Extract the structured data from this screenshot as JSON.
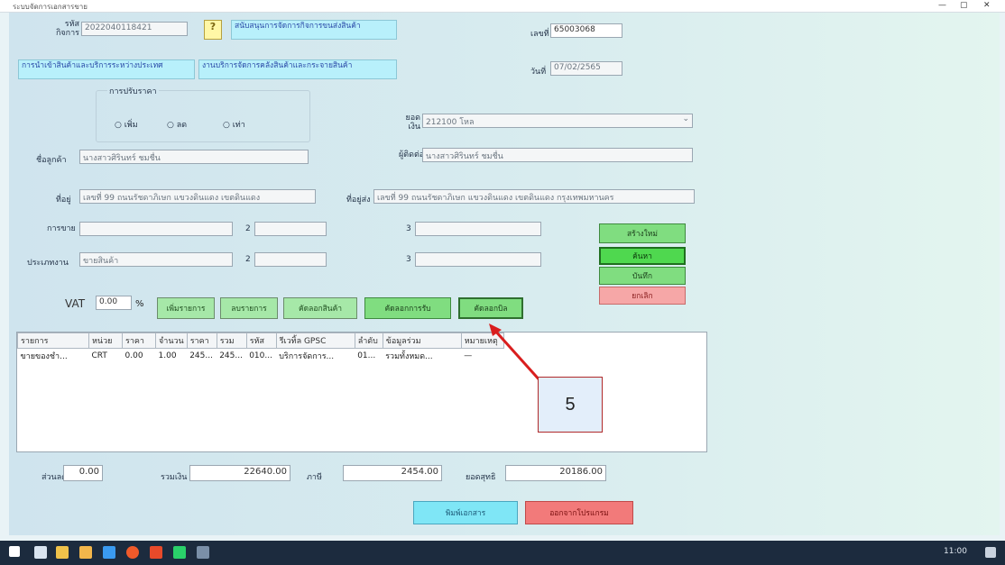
{
  "window": {
    "title": "ระบบจัดการเอกสารขาย",
    "controls": [
      "—",
      "▢",
      "✕"
    ]
  },
  "header": {
    "doc_no_label": "รหัส\nกิจการ",
    "doc_no_value": "2022040118421",
    "lookup_btn": "?",
    "company_desc": "สนับสนุนการจัดการกิจการขนส่งสินค้า",
    "blue_left": "การนำเข้าสินค้าและบริการระหว่างประเทศ",
    "blue_right": "งานบริการจัดการคลังสินค้าและกระจายสินค้า",
    "ref_label": "เลขที่",
    "ref_value": "65003068",
    "date_label": "วันที่",
    "date_value": "07/02/2565"
  },
  "purpose": {
    "group_label": "การปรับราคา",
    "options": [
      "เพิ่ม",
      "ลด",
      "เท่า"
    ]
  },
  "amount": {
    "label": "ยอด\nเงิน",
    "value": "212100 โหล"
  },
  "fields": {
    "customer_label": "ชื่อลูกค้า",
    "customer_value": "นางสาวศิรินทร์ ชมชื่น",
    "contact_label": "ผู้ติดต่อ",
    "contact_value": "นางสาวศิรินทร์ ชมชื่น",
    "address_label": "ที่อยู่",
    "address_value": "เลขที่ 99 ถนนรัชดาภิเษก แขวงดินแดง เขตดินแดง",
    "address2_label": "ที่อยู่ส่ง",
    "address2_value": "เลขที่ 99 ถนนรัชดาภิเษก แขวงดินแดง เขตดินแดง กรุงเทพมหานคร",
    "row1_label": "การขาย",
    "row1_col2": "2",
    "row1_col3": "3",
    "row2_label": "ประเภทงาน",
    "row2_value": "ขายสินค้า",
    "row2_col2": "2",
    "row2_col3": "3"
  },
  "side_buttons": [
    "สร้างใหม่",
    "ค้นหา",
    "บันทึก",
    "ยกเลิก"
  ],
  "vat": {
    "label": "VAT",
    "value": "0.00",
    "unit": "%"
  },
  "action_buttons": [
    "เพิ่มรายการ",
    "ลบรายการ",
    "คัดลอกสินค้า",
    "คัดลอกการรับ",
    "คัดลอกบิล"
  ],
  "grid": {
    "columns": [
      "รายการ",
      "หน่วย",
      "ราคา",
      "จำนวน",
      "ราคา",
      "รวม",
      "รหัส",
      "รีเวทิ้ล GPSC",
      "ลำดับ",
      "ข้อมูลร่วม",
      "หมายเหตุ"
    ],
    "rows": [
      [
        "ขายของชำ...",
        "CRT",
        "0.00",
        "1.00",
        "245...",
        "245...",
        "010...",
        "บริการจัดการ...",
        "01...",
        "รวมทั้งหมด...",
        "—"
      ]
    ]
  },
  "totals": {
    "discount_label": "ส่วนลด",
    "discount_value": "0.00",
    "subtotal_label": "รวมเงิน",
    "subtotal_value": "22640.00",
    "vat_label": "ภาษี",
    "vat_value": "2454.00",
    "grand_label": "ยอดสุทธิ",
    "grand_value": "20186.00"
  },
  "footer_buttons": {
    "print": "พิมพ์เอกสาร",
    "close": "ออกจากโปรแกรม"
  },
  "annotation": {
    "step": "5"
  },
  "taskbar": {
    "time": "11:00"
  }
}
